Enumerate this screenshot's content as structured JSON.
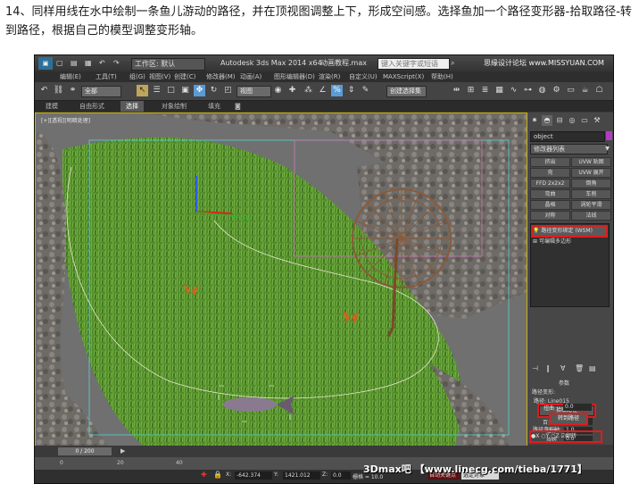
{
  "caption": "14、同样用线在水中绘制一条鱼儿游动的路径，并在顶视图调整上下，形成空间感。选择鱼加一个路径变形器-拾取路径-转到路径，根据自己的模型调整变形轴。",
  "titlebar": {
    "workspace_label": "工作区: 默认",
    "app_title": "Autodesk 3ds Max  2014 x64",
    "file_name": "动画教程.max",
    "search_placeholder": "键入关键字或短语",
    "site_logo": "思缘设计论坛 www.MISSYUAN.COM"
  },
  "menu": [
    "编辑(E)",
    "工具(T)",
    "组(G)",
    "视图(V)",
    "创建(C)",
    "修改器(M)",
    "动画(A)",
    "图形编辑器(D)",
    "渲染(R)",
    "自定义(U)",
    "MAXScript(X)",
    "帮助(H)"
  ],
  "toolbar": {
    "filter_select": "全部",
    "view_select": "视图",
    "selection_set": "创建选择集"
  },
  "ribbon_tabs": [
    {
      "label": "建模",
      "active": false
    },
    {
      "label": "自由形式",
      "active": false
    },
    {
      "label": "选择",
      "active": true
    },
    {
      "label": "对象绘制",
      "active": false
    },
    {
      "label": "填充",
      "active": false
    }
  ],
  "viewport": {
    "label": "[+][透视][明暗处理]"
  },
  "command_panel": {
    "object_name": "object",
    "object_color": "#b13dc0",
    "modifier_list": "修改器列表",
    "modifier_buttons": [
      "挤出",
      "UVW 贴图",
      "壳",
      "UVW 展开",
      "FFD 2x2x2",
      "倒角",
      "弯曲",
      "车削",
      "晶格",
      "涡轮平滑",
      "对称",
      "法线"
    ],
    "stack_items": [
      {
        "label": "路径变形绑定 (WSM)",
        "highlighted": true
      },
      {
        "label": "可编辑多边形",
        "highlighted": false
      }
    ],
    "params": {
      "rollout_title": "参数",
      "path_deform_label": "路径变形:",
      "path_label": "路径: Line015",
      "pick_path_button": "拾取路径",
      "percent_label": "百分比",
      "percent_value": "0.0",
      "stretch_label": "拉伸",
      "stretch_value": "1.0",
      "rotation_label": "旋转",
      "rotation_value": "0.0",
      "twist_label": "扭曲",
      "twist_value": "0.0",
      "move_to_path_button": "转到路径",
      "axis_label": "路径变形轴:",
      "axis_options": [
        "X",
        "Y",
        "Z"
      ],
      "axis_selected": "X",
      "flip_label": "翻转"
    }
  },
  "timeline": {
    "slider_label": "0 / 200",
    "ticks": [
      "0",
      "20",
      "40"
    ]
  },
  "status": {
    "x_value": "-642.374",
    "y_value": "1421.012",
    "z_value": "0.0",
    "grid_value": "栅格 = 10.0",
    "autokey_label": "自动关键点",
    "selected_label": "选定对象",
    "watermark": "3Dmax吧 【www.linecg.com/tieba/1771】"
  }
}
